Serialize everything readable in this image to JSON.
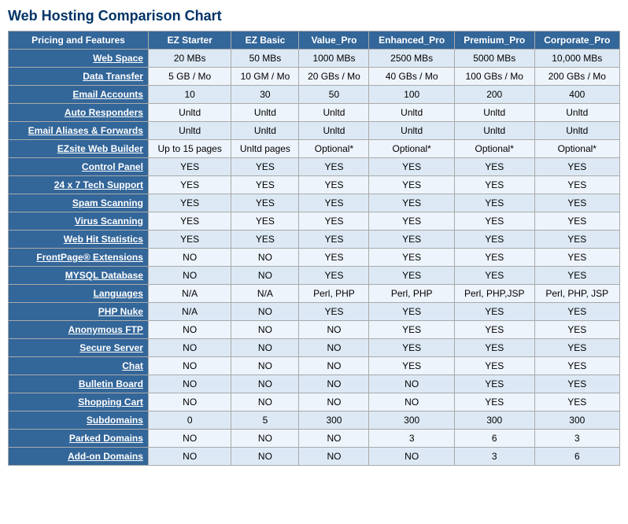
{
  "title": "Web Hosting Comparison Chart",
  "headers": [
    "Pricing and Features",
    "EZ Starter",
    "EZ Basic",
    "Value_Pro",
    "Enhanced_Pro",
    "Premium_Pro",
    "Corporate_Pro"
  ],
  "rows": [
    {
      "feature": "Web Space",
      "values": [
        "20 MBs",
        "50 MBs",
        "1000 MBs",
        "2500 MBs",
        "5000 MBs",
        "10,000 MBs"
      ]
    },
    {
      "feature": "Data Transfer",
      "values": [
        "5 GB / Mo",
        "10 GM / Mo",
        "20 GBs / Mo",
        "40 GBs / Mo",
        "100 GBs / Mo",
        "200 GBs / Mo"
      ]
    },
    {
      "feature": "Email Accounts",
      "values": [
        "10",
        "30",
        "50",
        "100",
        "200",
        "400"
      ]
    },
    {
      "feature": "Auto Responders",
      "values": [
        "Unltd",
        "Unltd",
        "Unltd",
        "Unltd",
        "Unltd",
        "Unltd"
      ]
    },
    {
      "feature": "Email Aliases & Forwards",
      "values": [
        "Unltd",
        "Unltd",
        "Unltd",
        "Unltd",
        "Unltd",
        "Unltd"
      ]
    },
    {
      "feature": "EZsite Web Builder",
      "values": [
        "Up to 15 pages",
        "Unltd pages",
        "Optional*",
        "Optional*",
        "Optional*",
        "Optional*"
      ]
    },
    {
      "feature": "Control Panel",
      "values": [
        "YES",
        "YES",
        "YES",
        "YES",
        "YES",
        "YES"
      ]
    },
    {
      "feature": "24 x 7 Tech Support",
      "values": [
        "YES",
        "YES",
        "YES",
        "YES",
        "YES",
        "YES"
      ]
    },
    {
      "feature": "Spam Scanning",
      "values": [
        "YES",
        "YES",
        "YES",
        "YES",
        "YES",
        "YES"
      ]
    },
    {
      "feature": "Virus Scanning",
      "values": [
        "YES",
        "YES",
        "YES",
        "YES",
        "YES",
        "YES"
      ]
    },
    {
      "feature": "Web Hit Statistics",
      "values": [
        "YES",
        "YES",
        "YES",
        "YES",
        "YES",
        "YES"
      ]
    },
    {
      "feature": "FrontPage® Extensions",
      "values": [
        "NO",
        "NO",
        "YES",
        "YES",
        "YES",
        "YES"
      ]
    },
    {
      "feature": "MYSQL Database",
      "values": [
        "NO",
        "NO",
        "YES",
        "YES",
        "YES",
        "YES"
      ]
    },
    {
      "feature": "Languages",
      "values": [
        "N/A",
        "N/A",
        "Perl, PHP",
        "Perl, PHP",
        "Perl, PHP,JSP",
        "Perl, PHP, JSP"
      ]
    },
    {
      "feature": "PHP Nuke",
      "values": [
        "N/A",
        "NO",
        "YES",
        "YES",
        "YES",
        "YES"
      ]
    },
    {
      "feature": "Anonymous FTP",
      "values": [
        "NO",
        "NO",
        "NO",
        "YES",
        "YES",
        "YES"
      ]
    },
    {
      "feature": "Secure Server",
      "values": [
        "NO",
        "NO",
        "NO",
        "YES",
        "YES",
        "YES"
      ]
    },
    {
      "feature": "Chat",
      "values": [
        "NO",
        "NO",
        "NO",
        "YES",
        "YES",
        "YES"
      ]
    },
    {
      "feature": "Bulletin Board",
      "values": [
        "NO",
        "NO",
        "NO",
        "NO",
        "YES",
        "YES"
      ]
    },
    {
      "feature": "Shopping Cart",
      "values": [
        "NO",
        "NO",
        "NO",
        "NO",
        "YES",
        "YES"
      ]
    },
    {
      "feature": "Subdomains",
      "values": [
        "0",
        "5",
        "300",
        "300",
        "300",
        "300"
      ]
    },
    {
      "feature": "Parked Domains",
      "values": [
        "NO",
        "NO",
        "NO",
        "3",
        "6",
        "3"
      ]
    },
    {
      "feature": "Add-on Domains",
      "values": [
        "NO",
        "NO",
        "NO",
        "NO",
        "3",
        "6"
      ]
    }
  ]
}
